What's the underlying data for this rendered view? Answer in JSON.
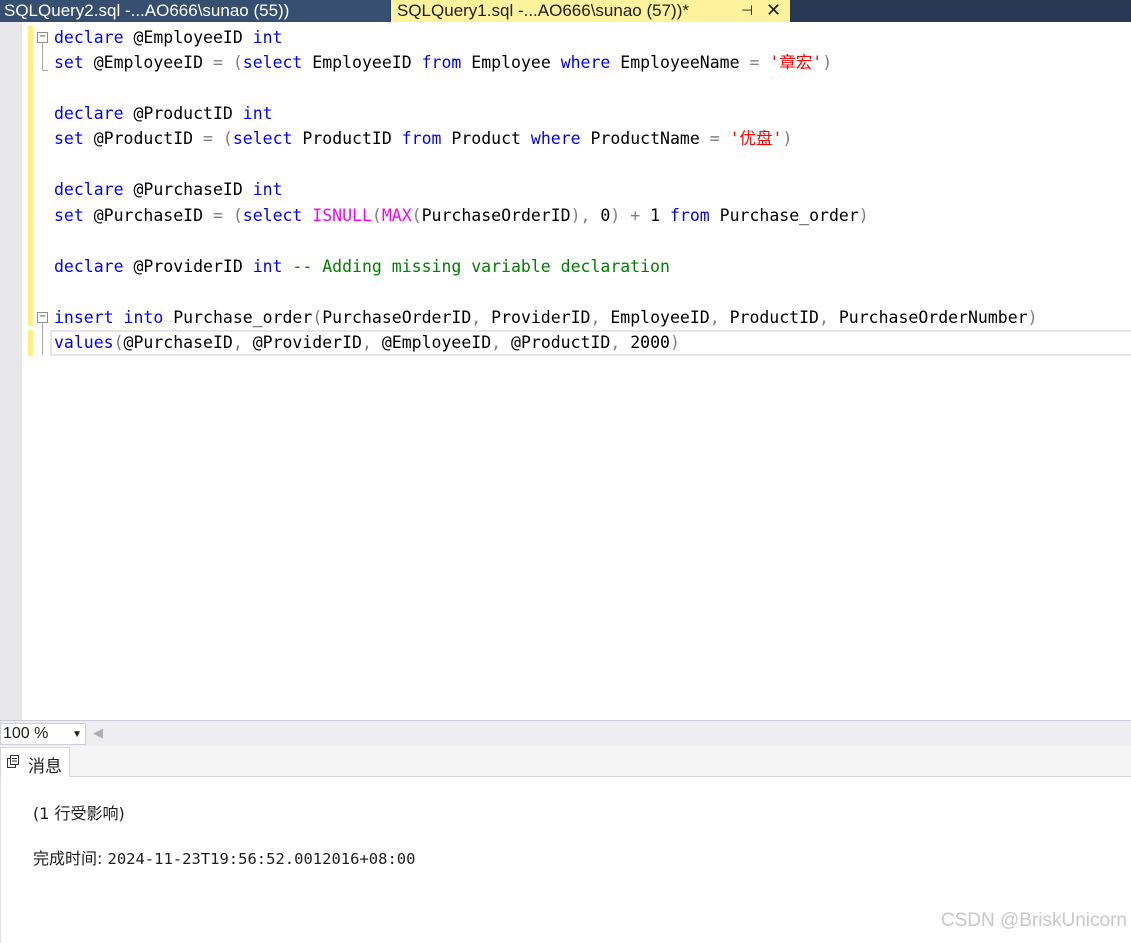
{
  "tabs": {
    "inactive": {
      "label": "SQLQuery2.sql -...AO666\\sunao (55))"
    },
    "active": {
      "label": "SQLQuery1.sql -...AO666\\sunao (57))*",
      "pin_glyph": "⊣",
      "close_glyph": "✕"
    }
  },
  "editor": {
    "fold_glyph": "−",
    "lines": {
      "l1": {
        "kw1": "declare",
        "t1": " @EmployeeID ",
        "kw2": "int"
      },
      "l2": {
        "kw1": "set",
        "t1": " @EmployeeID ",
        "g1": "= (",
        "kw2": "select",
        "t2": " EmployeeID ",
        "kw3": "from",
        "t3": " Employee ",
        "kw4": "where",
        "t4": " EmployeeName ",
        "g2": "= ",
        "str": "'章宏'",
        "g3": ")"
      },
      "l4": {
        "kw1": "declare",
        "t1": " @ProductID ",
        "kw2": "int"
      },
      "l5": {
        "kw1": "set",
        "t1": " @ProductID ",
        "g1": "= (",
        "kw2": "select",
        "t2": " ProductID ",
        "kw3": "from",
        "t3": " Product ",
        "kw4": "where",
        "t4": " ProductName ",
        "g2": "= ",
        "str": "'优盘'",
        "g3": ")"
      },
      "l7": {
        "kw1": "declare",
        "t1": " @PurchaseID ",
        "kw2": "int"
      },
      "l8": {
        "kw1": "set",
        "t1": " @PurchaseID ",
        "g1": "= (",
        "kw2": "select",
        "sp": " ",
        "fn1": "ISNULL",
        "g2": "(",
        "fn2": "MAX",
        "g3": "(",
        "t2": "PurchaseOrderID",
        "g4": "),",
        "t3": " 0",
        "g5": ") + ",
        "t4": "1 ",
        "kw3": "from",
        "t5": " Purchase_order",
        "g6": ")"
      },
      "l10": {
        "kw1": "declare",
        "t1": " @ProviderID ",
        "kw2": "int",
        "cmt": " -- Adding missing variable declaration"
      },
      "l12": {
        "kw1": "insert",
        "sp": " ",
        "kw2": "into",
        "t1": " Purchase_order",
        "g1": "(",
        "t2": "PurchaseOrderID",
        "g2": ",",
        "t3": " ProviderID",
        "g3": ",",
        "t4": " EmployeeID",
        "g4": ",",
        "t5": " ProductID",
        "g5": ",",
        "t6": " PurchaseOrderNumber",
        "g6": ")"
      },
      "l13": {
        "kw1": "values",
        "g1": "(",
        "t1": "@PurchaseID",
        "g2": ",",
        "t2": " @ProviderID",
        "g3": ",",
        "t3": " @EmployeeID",
        "g4": ",",
        "t4": " @ProductID",
        "g5": ",",
        "t5": " 2000",
        "g6": ")"
      }
    }
  },
  "status": {
    "zoom": "100 %",
    "dropdown_glyph": "▼",
    "scroll_left_glyph": "◀"
  },
  "results": {
    "tab_label": "消息",
    "rows_affected": "(1 行受影响)",
    "completion_label": "完成时间: ",
    "completion_time": "2024-11-23T19:56:52.0012016+08:00"
  },
  "watermark": "CSDN @BriskUnicorn",
  "colors": {
    "keyword": "#0000ff",
    "string": "#ff0000",
    "operator": "#808080",
    "function": "#ff00ff",
    "comment": "#008000",
    "active_tab": "#fff29d",
    "tabbar": "#293955"
  }
}
